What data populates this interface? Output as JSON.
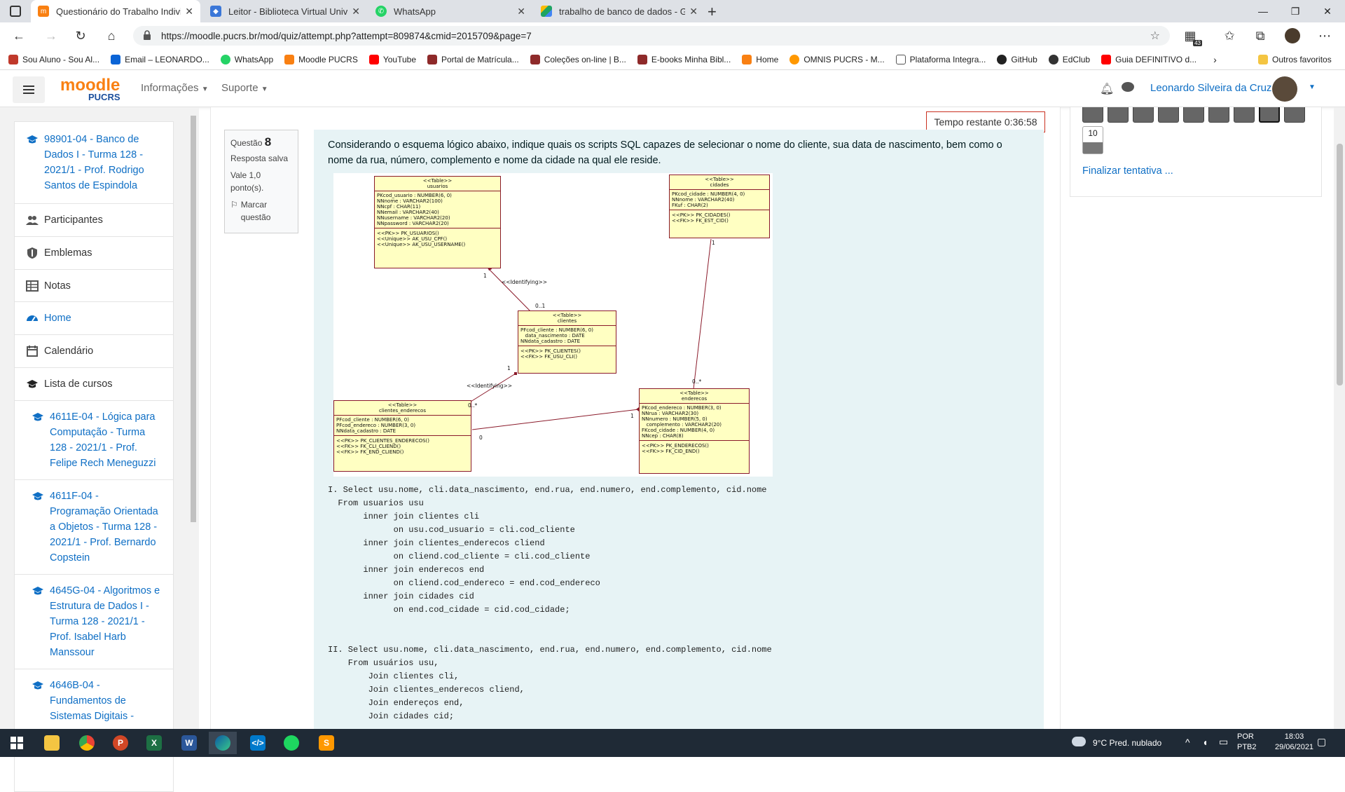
{
  "tabs": [
    {
      "title": "Questionário do Trabalho Individ",
      "color": "#f98012",
      "active": true
    },
    {
      "title": "Leitor - Biblioteca Virtual Univers",
      "color": "#3b77d8",
      "active": false
    },
    {
      "title": "WhatsApp",
      "color": "#25d366",
      "active": false
    },
    {
      "title": "trabalho de banco de dados - Go",
      "color": "#1fa463",
      "active": false
    }
  ],
  "browser": {
    "url": "https://moodle.pucrs.br/mod/quiz/attempt.php?attempt=809874&cmid=2015709&page=7",
    "ext_badge": "43"
  },
  "bookmarks": [
    {
      "label": "Sou Aluno - Sou Al...",
      "color": "#c0392b"
    },
    {
      "label": "Email – LEONARDO...",
      "color": "#0a64d6"
    },
    {
      "label": "WhatsApp",
      "color": "#25d366"
    },
    {
      "label": "Moodle PUCRS",
      "color": "#f98012"
    },
    {
      "label": "YouTube",
      "color": "#ff0000"
    },
    {
      "label": "Portal de Matrícula...",
      "color": "#8e2a2a"
    },
    {
      "label": "Coleções on-line | B...",
      "color": "#8e2a2a"
    },
    {
      "label": "E-books Minha Bibl...",
      "color": "#8e2a2a"
    },
    {
      "label": "Home",
      "color": "#f98012"
    },
    {
      "label": "OMNIS PUCRS - M...",
      "color": "#ff9800"
    },
    {
      "label": "Plataforma Integra...",
      "color": "#ffffff"
    },
    {
      "label": "GitHub",
      "color": "#222222"
    },
    {
      "label": "EdClub",
      "color": "#333333"
    },
    {
      "label": "Guia DEFINITIVO d...",
      "color": "#ff0000"
    }
  ],
  "bookmarks_other": "Outros favoritos",
  "header": {
    "menu": [
      "Informações",
      "Suporte"
    ],
    "user_name": "Leonardo Silveira da Cruz"
  },
  "drawer": {
    "course": "98901-04 - Banco de Dados I - Turma 128 - 2021/1 - Prof. Rodrigo Santos de Espindola",
    "items": [
      "Participantes",
      "Emblemas",
      "Notas"
    ],
    "nav": [
      "Home",
      "Calendário",
      "Lista de cursos"
    ],
    "courses": [
      "4611E-04 - Lógica para Computação - Turma 128 - 2021/1 - Prof. Felipe Rech Meneguzzi",
      "4611F-04 - Programação Orientada a Objetos - Turma 128 - 2021/1 - Prof. Bernardo Copstein",
      "4645G-04 - Algoritmos e Estrutura de Dados I - Turma 128 - 2021/1 - Prof. Isabel Harb Manssour",
      "4646B-04 - Fundamentos de Sistemas Digitais -"
    ]
  },
  "question": {
    "label": "Questão",
    "number": "8",
    "status": "Resposta salva",
    "value": "Vale 1,0 ponto(s).",
    "flag": "Marcar questão",
    "text": "Considerando o esquema lógico abaixo, indique quais os scripts SQL capazes de selecionar o nome do cliente, sua data de nascimento, bem como o nome da rua, número, complemento e nome da cidade na qual ele reside.",
    "timer": "Tempo restante 0:36:58"
  },
  "diagram": {
    "usuarios": {
      "stereo": "<<Table>>",
      "name": "usuarios",
      "cols": "PKcod_usuario : NUMBER(6, 0)\nNNnome : VARCHAR2(100)\nNNcpf : CHAR(11)\nNNemail : VARCHAR2(40)\nNNusername : VARCHAR2(20)\nNNpassword : VARCHAR2(20)",
      "ops": "<<PK>> PK_USUARIOS()\n<<Unique>> AK_USU_CPF()\n<<Unique>> AK_USU_USERNAME()"
    },
    "cidades": {
      "stereo": "<<Table>>",
      "name": "cidades",
      "cols": "PKcod_cidade : NUMBER(4, 0)\nNNnome : VARCHAR2(40)\nFKuf : CHAR(2)",
      "ops": "<<PK>> PK_CIDADES()\n<<FK>> FK_EST_CID()"
    },
    "clientes": {
      "stereo": "<<Table>>",
      "name": "clientes",
      "cols": "PFcod_cliente : NUMBER(6, 0)\n   data_nascimento : DATE\nNNdata_cadastro : DATE",
      "ops": "<<PK>> PK_CLIENTES()\n<<FK>> FK_USU_CLI()"
    },
    "clientes_enderecos": {
      "stereo": "<<Table>>",
      "name": "clientes_enderecos",
      "cols": "PFcod_cliente : NUMBER(6, 0)\nPFcod_endereco : NUMBER(3, 0)\nNNdata_cadastro : DATE",
      "ops": "<<PK>> PK_CLIENTES_ENDERECOS()\n<<FK>> FK_CLI_CLIEND()\n<<FK>> FK_END_CLIEND()"
    },
    "enderecos": {
      "stereo": "<<Table>>",
      "name": "enderecos",
      "cols": "PKcod_endereco : NUMBER(3, 0)\nNNrua : VARCHAR2(30)\nNNnumero : NUMBER(5, 0)\n   complemento : VARCHAR2(20)\nFKcod_cidade : NUMBER(4, 0)\nNNcep : CHAR(8)",
      "ops": "<<PK>> PK_ENDERECOS()\n<<FK>> FK_CID_END()"
    },
    "labels": {
      "identifying": "<<Identifying>>",
      "one": "1",
      "zero_one": "0..1",
      "zero_many": "0..*",
      "zero": "0"
    }
  },
  "sql": "I. Select usu.nome, cli.data_nascimento, end.rua, end.numero, end.complemento, cid.nome\n  From usuarios usu\n       inner join clientes cli\n             on usu.cod_usuario = cli.cod_cliente\n       inner join clientes_enderecos cliend\n             on cliend.cod_cliente = cli.cod_cliente\n       inner join enderecos end\n             on cliend.cod_endereco = end.cod_endereco\n       inner join cidades cid\n             on end.cod_cidade = cid.cod_cidade;\n\n\nII. Select usu.nome, cli.data_nascimento, end.rua, end.numero, end.complemento, cid.nome\n    From usuários usu,\n        Join clientes cli,\n        Join clientes_enderecos cliend,\n        Join endereços end,\n        Join cidades cid;",
  "quiz_nav": {
    "last_number": "10",
    "finish": "Finalizar tentativa ..."
  },
  "taskbar": {
    "weather": "9°C  Pred. nublado",
    "lang1": "POR",
    "lang2": "PTB2",
    "time": "18:03",
    "date": "29/06/2021"
  }
}
